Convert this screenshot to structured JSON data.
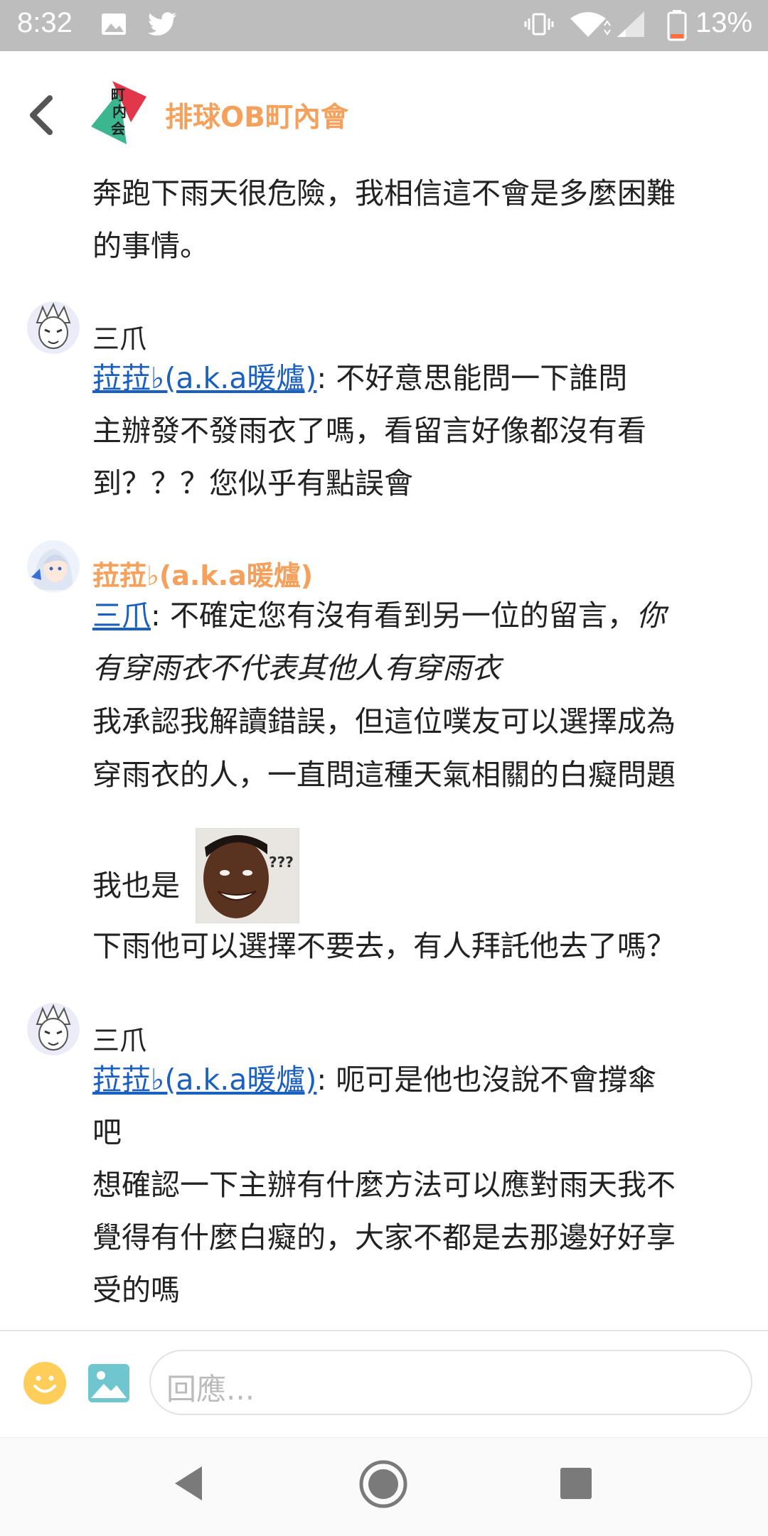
{
  "status": {
    "time": "8:32",
    "battery": "13%"
  },
  "header": {
    "title": "排球OB町內會",
    "logo_text": "町\n内\n会"
  },
  "messages": {
    "m0": {
      "lines": [
        "奔跑下雨天很危險，我相信這不會是多麼困難",
        "的事情。"
      ]
    },
    "m1": {
      "name": "三爪",
      "mention": "菈菈♭(a.k.a暖爐)",
      "line1_rest": ": 不好意思能問一下誰問",
      "lines": [
        "主辦發不發雨衣了嗎，看留言好像都沒有看",
        "到？？？您似乎有點誤會"
      ]
    },
    "m2": {
      "name": "菈菈♭(a.k.a暖爐)",
      "mention": "三爪",
      "line1_rest": ": 不確定您有沒有看到另一位的留言，",
      "line1_italic": "你",
      "line2_italic": "有穿雨衣不代表其他人有穿雨衣",
      "lines": [
        "我承認我解讀錯誤，但這位噗友可以選擇成為",
        "穿雨衣的人，一直問這種天氣相關的白癡問題"
      ],
      "me_too": "我也是",
      "meme_text": "???",
      "last_line": "下雨他可以選擇不要去，有人拜託他去了嗎？"
    },
    "m3": {
      "name": "三爪",
      "mention": "菈菈♭(a.k.a暖爐)",
      "line1_rest": ": 呃可是他也沒說不會撐傘",
      "lines": [
        "吧",
        "想確認一下主辦有什麼方法可以應對雨天我不",
        "覺得有什麼白癡的，大家不都是去那邊好好享",
        "受的嗎"
      ]
    }
  },
  "composer": {
    "placeholder": "回應..."
  },
  "colors": {
    "accent": "#f5a15b",
    "link": "#1b5fbf",
    "statusbar": "#bdbdbd"
  }
}
